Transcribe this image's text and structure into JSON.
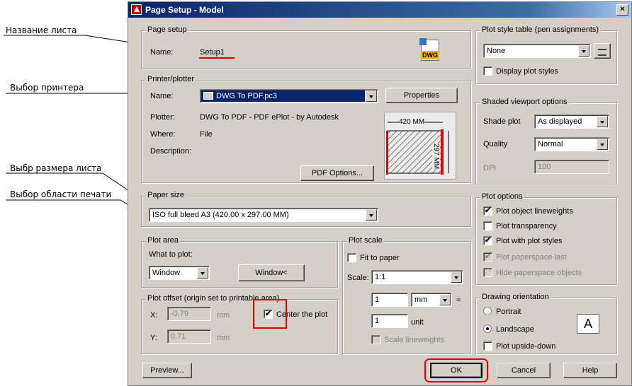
{
  "callouts": {
    "sheet_name": "Название листа",
    "printer": "Выбор принтера",
    "paper_size": "Выбр размера листа",
    "plot_area": "Выбор области печати"
  },
  "window": {
    "title": "Page Setup - Model",
    "close_glyph": "×"
  },
  "page_setup": {
    "label": "Page setup",
    "name_label": "Name:",
    "name_value": "Setup1",
    "icon_text": "DWG"
  },
  "printer": {
    "label": "Printer/plotter",
    "name_label": "Name:",
    "name_value": "DWG To PDF.pc3",
    "properties_button": "Properties",
    "plotter_label": "Plotter:",
    "plotter_value": "DWG To PDF - PDF ePlot - by Autodesk",
    "where_label": "Where:",
    "where_value": "File",
    "description_label": "Description:",
    "pdf_options_button": "PDF Options...",
    "preview_width": "420 MM",
    "preview_height": "297 MM"
  },
  "paper_size": {
    "label": "Paper size",
    "value": "ISO full bleed A3 (420.00 x 297.00 MM)"
  },
  "plot_area": {
    "label": "Plot area",
    "what_label": "What to plot:",
    "what_value": "Window",
    "window_button": "Window<"
  },
  "plot_offset": {
    "label": "Plot offset (origin set to printable area)",
    "x_label": "X:",
    "x_value": "-0.79",
    "x_unit": "mm",
    "y_label": "Y:",
    "y_value": "0.71",
    "y_unit": "mm",
    "center_label": "Center the plot",
    "center_checked": "✔"
  },
  "plot_scale": {
    "label": "Plot scale",
    "fit_label": "Fit to paper",
    "scale_label": "Scale:",
    "scale_value": "1:1",
    "num_value": "1",
    "num_unit": "mm",
    "equals": "=",
    "den_value": "1",
    "den_unit": "unit",
    "lineweights_label": "Scale lineweights"
  },
  "plot_style": {
    "label": "Plot style table (pen assignments)",
    "value": "None",
    "display_label": "Display plot styles"
  },
  "shaded": {
    "label": "Shaded viewport options",
    "shade_label": "Shade plot",
    "shade_value": "As displayed",
    "quality_label": "Quality",
    "quality_value": "Normal",
    "dpi_label": "DPI",
    "dpi_value": "100"
  },
  "plot_options": {
    "label": "Plot options",
    "lineweights": "Plot object lineweights",
    "transparency": "Plot transparency",
    "with_styles": "Plot with plot styles",
    "paperspace_last": "Plot paperspace last",
    "hide_paperspace": "Hide paperspace objects",
    "check": "✔"
  },
  "orientation": {
    "label": "Drawing orientation",
    "portrait": "Portrait",
    "landscape": "Landscape",
    "upside_down": "Plot upside-down",
    "icon_letter": "A"
  },
  "footer": {
    "preview_button": "Preview...",
    "ok_button": "OK",
    "cancel_button": "Cancel",
    "help_button": "Help"
  },
  "colors": {
    "annotation_red": "#e00000",
    "title_bar": "#0a246a",
    "dialog_face": "#d4d0c8"
  }
}
